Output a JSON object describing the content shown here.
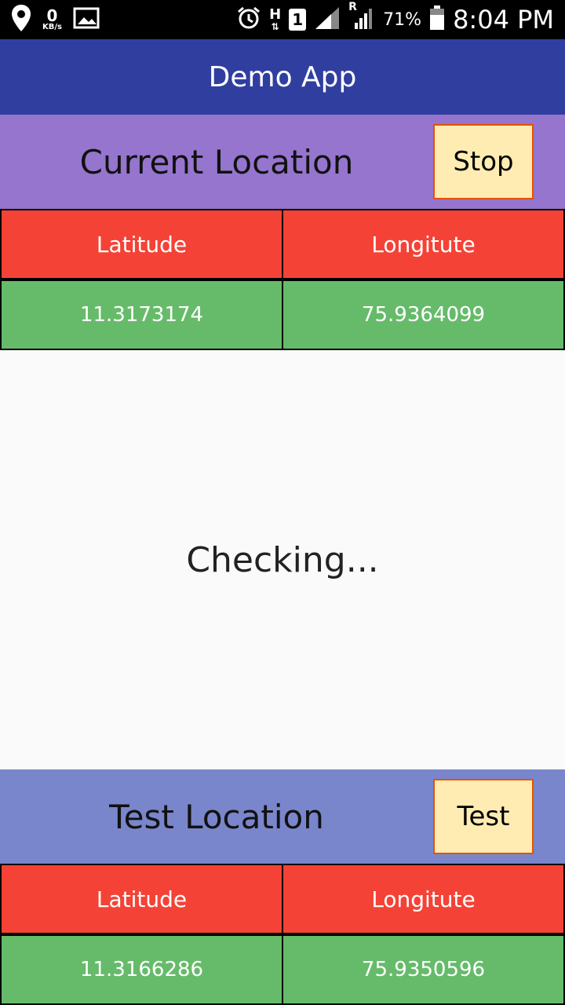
{
  "statusbar": {
    "data_rate": "0",
    "data_unit": "KB/s",
    "network_type": "H",
    "sim_slot": "1",
    "roaming": "R",
    "battery": "71%",
    "time": "8:04 PM"
  },
  "app": {
    "title": "Demo App"
  },
  "current": {
    "title": "Current Location",
    "button": "Stop",
    "lat_label": "Latitude",
    "lon_label": "Longitute",
    "lat": "11.3173174",
    "lon": "75.9364099"
  },
  "status_message": "Checking...",
  "test": {
    "title": "Test Location",
    "button": "Test",
    "lat_label": "Latitude",
    "lon_label": "Longitute",
    "lat": "11.3166286",
    "lon": "75.9350596"
  },
  "colors": {
    "appbar": "#303f9f",
    "current_header": "#9575cd",
    "test_header": "#7986cb",
    "cell_header": "#f44336",
    "cell_value": "#66bb6a",
    "button_bg": "#ffecb3",
    "button_border": "#e65100"
  }
}
